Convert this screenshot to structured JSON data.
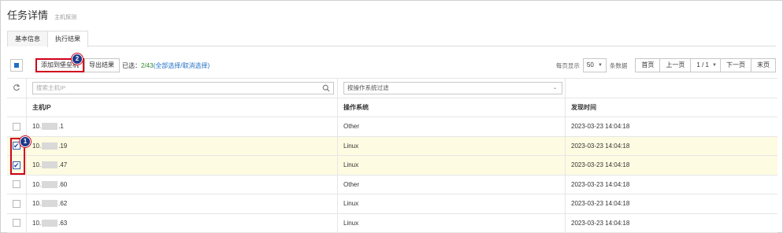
{
  "header": {
    "title": "任务详情",
    "subtitle": "主机探测"
  },
  "tabs": [
    {
      "label": "基本信息",
      "active": false
    },
    {
      "label": "执行结果",
      "active": true
    }
  ],
  "toolbar": {
    "add_button": "添加到堡垒机",
    "export_button": "导出结果",
    "selected_prefix": "已选：",
    "selected_count": "2/43",
    "select_links": "(全部选择/取消选择)"
  },
  "pagination": {
    "per_page_label": "每页显示",
    "page_size": "50",
    "records_label": "条数据",
    "first": "首页",
    "prev": "上一页",
    "page_info": "1 / 1",
    "next": "下一页",
    "last": "末页"
  },
  "filters": {
    "ip_placeholder": "搜索主机IP",
    "os_filter": "按操作系统过滤"
  },
  "columns": {
    "ip": "主机IP",
    "os": "操作系统",
    "time": "发现时间"
  },
  "rows": [
    {
      "ip_prefix": "10.",
      "ip_suffix": ".1",
      "os": "Other",
      "time": "2023-03-23 14:04:18",
      "checked": false
    },
    {
      "ip_prefix": "10.",
      "ip_suffix": ".19",
      "os": "Linux",
      "time": "2023-03-23 14:04:18",
      "checked": true
    },
    {
      "ip_prefix": "10.",
      "ip_suffix": ".47",
      "os": "Linux",
      "time": "2023-03-23 14:04:18",
      "checked": true
    },
    {
      "ip_prefix": "10.",
      "ip_suffix": ".60",
      "os": "Other",
      "time": "2023-03-23 14:04:18",
      "checked": false
    },
    {
      "ip_prefix": "10.",
      "ip_suffix": ".62",
      "os": "Linux",
      "time": "2023-03-23 14:04:18",
      "checked": false
    },
    {
      "ip_prefix": "10.",
      "ip_suffix": ".63",
      "os": "Linux",
      "time": "2023-03-23 14:04:18",
      "checked": false
    }
  ],
  "annotations": {
    "step1": "1",
    "step2": "2"
  },
  "icons": {
    "refresh": "refresh-icon",
    "search": "search-icon",
    "caret": "chevron-down-icon"
  },
  "colors": {
    "accent": "#1f6fc5",
    "highlight_row": "#fdfbe1",
    "callout_border": "#d0021b",
    "badge": "#1c3a8c"
  }
}
